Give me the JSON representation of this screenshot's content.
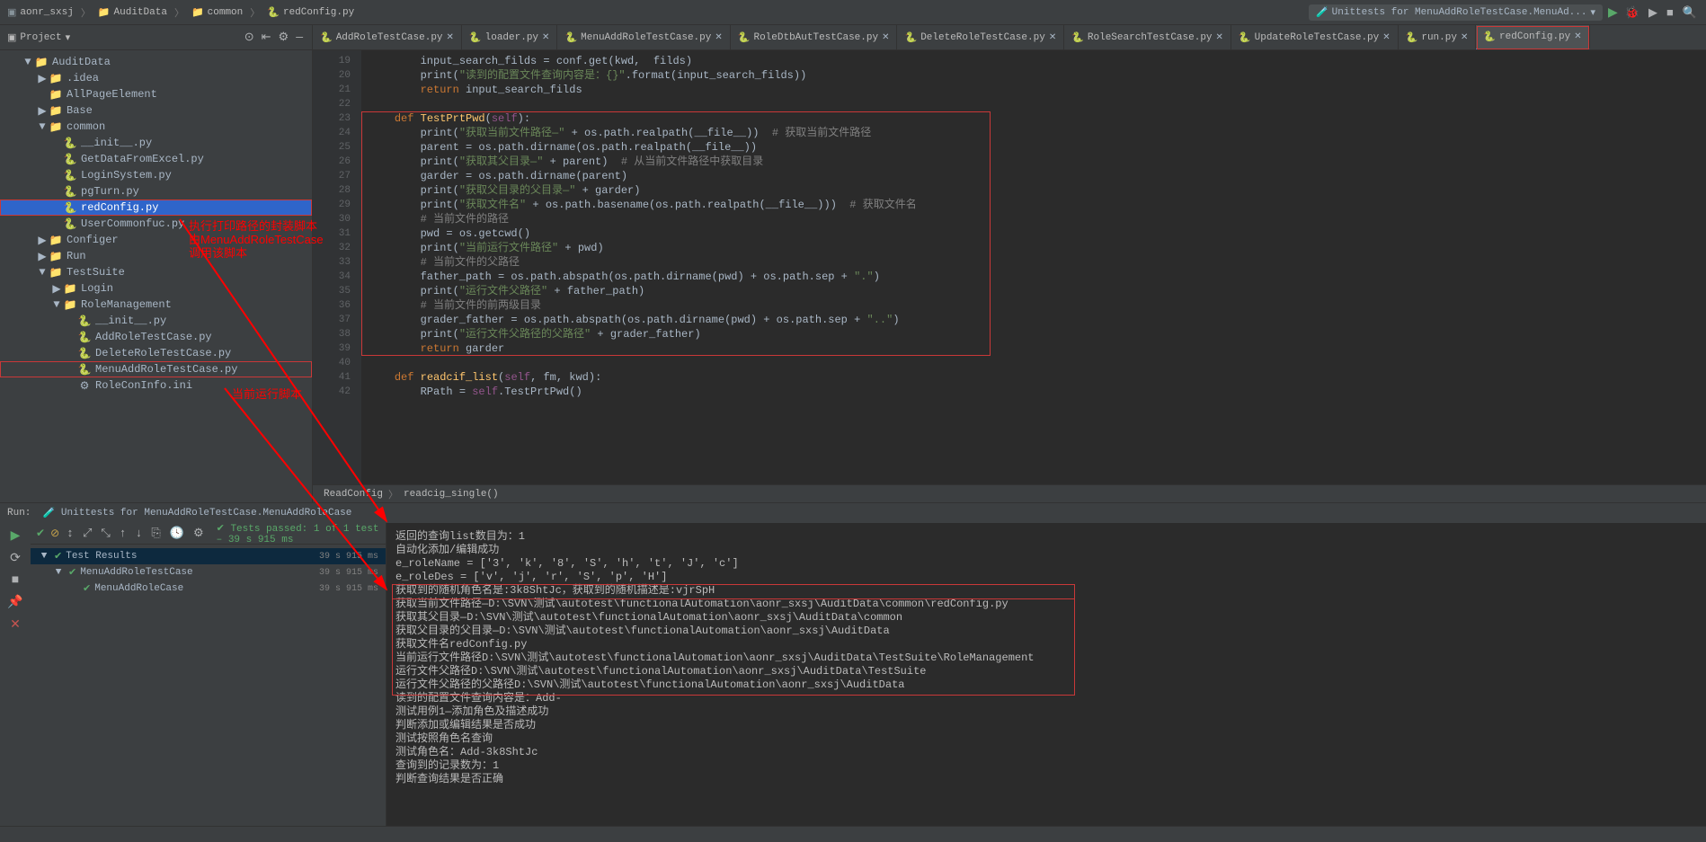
{
  "breadcrumbs": [
    "aonr_sxsj",
    "AuditData",
    "common",
    "redConfig.py"
  ],
  "runConfig": "Unittests for MenuAddRoleTestCase.MenuAd...",
  "sidebar": {
    "title": "Project"
  },
  "tree": [
    {
      "indent": 1,
      "arrow": "▼",
      "icon": "📁",
      "label": "AuditData",
      "type": "folder"
    },
    {
      "indent": 2,
      "arrow": "▶",
      "icon": "📁",
      "label": ".idea",
      "type": "folder"
    },
    {
      "indent": 2,
      "arrow": "",
      "icon": "📁",
      "label": "AllPageElement",
      "type": "folder"
    },
    {
      "indent": 2,
      "arrow": "▶",
      "icon": "📁",
      "label": "Base",
      "type": "folder"
    },
    {
      "indent": 2,
      "arrow": "▼",
      "icon": "📁",
      "label": "common",
      "type": "folder"
    },
    {
      "indent": 3,
      "arrow": "",
      "icon": "🐍",
      "label": "__init__.py",
      "type": "py"
    },
    {
      "indent": 3,
      "arrow": "",
      "icon": "🐍",
      "label": "GetDataFromExcel.py",
      "type": "py"
    },
    {
      "indent": 3,
      "arrow": "",
      "icon": "🐍",
      "label": "LoginSystem.py",
      "type": "py"
    },
    {
      "indent": 3,
      "arrow": "",
      "icon": "🐍",
      "label": "pgTurn.py",
      "type": "py"
    },
    {
      "indent": 3,
      "arrow": "",
      "icon": "🐍",
      "label": "redConfig.py",
      "type": "py",
      "selected": true,
      "boxed": true
    },
    {
      "indent": 3,
      "arrow": "",
      "icon": "🐍",
      "label": "UserCommonfuc.py",
      "type": "py"
    },
    {
      "indent": 2,
      "arrow": "▶",
      "icon": "📁",
      "label": "Configer",
      "type": "folder"
    },
    {
      "indent": 2,
      "arrow": "▶",
      "icon": "📁",
      "label": "Run",
      "type": "folder"
    },
    {
      "indent": 2,
      "arrow": "▼",
      "icon": "📁",
      "label": "TestSuite",
      "type": "folder"
    },
    {
      "indent": 3,
      "arrow": "▶",
      "icon": "📁",
      "label": "Login",
      "type": "folder"
    },
    {
      "indent": 3,
      "arrow": "▼",
      "icon": "📁",
      "label": "RoleManagement",
      "type": "folder"
    },
    {
      "indent": 4,
      "arrow": "",
      "icon": "🐍",
      "label": "__init__.py",
      "type": "py"
    },
    {
      "indent": 4,
      "arrow": "",
      "icon": "🐍",
      "label": "AddRoleTestCase.py",
      "type": "py"
    },
    {
      "indent": 4,
      "arrow": "",
      "icon": "🐍",
      "label": "DeleteRoleTestCase.py",
      "type": "py"
    },
    {
      "indent": 4,
      "arrow": "",
      "icon": "🐍",
      "label": "MenuAddRoleTestCase.py",
      "type": "py",
      "boxed": true
    },
    {
      "indent": 4,
      "arrow": "",
      "icon": "⚙",
      "label": "RoleConInfo.ini",
      "type": "ini"
    }
  ],
  "tabs": [
    {
      "label": "AddRoleTestCase.py"
    },
    {
      "label": "loader.py"
    },
    {
      "label": "MenuAddRoleTestCase.py"
    },
    {
      "label": "RoleDtbAutTestCase.py"
    },
    {
      "label": "DeleteRoleTestCase.py"
    },
    {
      "label": "RoleSearchTestCase.py"
    },
    {
      "label": "UpdateRoleTestCase.py"
    },
    {
      "label": "run.py"
    },
    {
      "label": "redConfig.py",
      "active": true,
      "highlighted": true
    }
  ],
  "gutter": [
    "19",
    "20",
    "21",
    "22",
    "23",
    "24",
    "25",
    "26",
    "27",
    "28",
    "29",
    "30",
    "31",
    "32",
    "33",
    "34",
    "35",
    "36",
    "37",
    "38",
    "39",
    "40",
    "41",
    "42"
  ],
  "codeBreadcrumb": [
    "ReadConfig",
    "readcig_single()"
  ],
  "annotations": {
    "line1": "执行打印路径的封装脚本",
    "line2": "由MenuAddRoleTestCase",
    "line3": "调用该脚本",
    "line4": "当前运行脚本"
  },
  "runPanel": {
    "title": "Unittests for MenuAddRoleTestCase.MenuAddRoleCase",
    "statusText": "Tests passed: 1 of 1 test – 39 s 915 ms",
    "tests": [
      {
        "label": "Test Results",
        "time": "39 s 915 ms",
        "selected": true,
        "arrow": "▼"
      },
      {
        "label": "MenuAddRoleTestCase",
        "time": "39 s 915 ms",
        "indent": 1,
        "arrow": "▼"
      },
      {
        "label": "MenuAddRoleCase",
        "time": "39 s 915 ms",
        "indent": 2
      }
    ],
    "output": [
      "返回的查询list数目为：1",
      "自动化添加/编辑成功",
      "e_roleName = ['3', 'k', '8', 'S', 'h', 't', 'J', 'c']",
      "e_roleDes = ['v', 'j', 'r', 'S', 'p', 'H']",
      "获取到的随机角色名是:3k8ShtJc，获取到的随机描述是:vjrSpH",
      "获取当前文件路径—D:\\SVN\\测试\\autotest\\functionalAutomation\\aonr_sxsj\\AuditData\\common\\redConfig.py",
      "获取其父目录—D:\\SVN\\测试\\autotest\\functionalAutomation\\aonr_sxsj\\AuditData\\common",
      "获取父目录的父目录—D:\\SVN\\测试\\autotest\\functionalAutomation\\aonr_sxsj\\AuditData",
      "获取文件名redConfig.py",
      "当前运行文件路径D:\\SVN\\测试\\autotest\\functionalAutomation\\aonr_sxsj\\AuditData\\TestSuite\\RoleManagement",
      "运行文件父路径D:\\SVN\\测试\\autotest\\functionalAutomation\\aonr_sxsj\\AuditData\\TestSuite",
      "运行文件父路径的父路径D:\\SVN\\测试\\autotest\\functionalAutomation\\aonr_sxsj\\AuditData",
      "读到的配置文件查询内容是：Add-",
      "测试用例1—添加角色及描述成功",
      "判断添加或编辑结果是否成功",
      "测试按照角色名查询",
      "测试角色名：Add-3k8ShtJc",
      "查询到的记录数为：1",
      "判断查询结果是否正确"
    ]
  }
}
